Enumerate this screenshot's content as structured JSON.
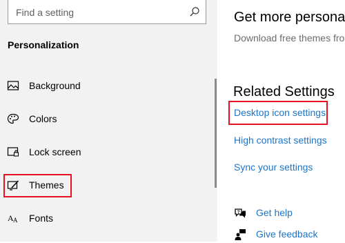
{
  "search": {
    "placeholder": "Find a setting",
    "icon": "search-icon"
  },
  "sidebar": {
    "section_title": "Personalization",
    "items": [
      {
        "label": "Background",
        "icon": "background-image-icon"
      },
      {
        "label": "Colors",
        "icon": "palette-icon"
      },
      {
        "label": "Lock screen",
        "icon": "lock-screen-icon"
      },
      {
        "label": "Themes",
        "icon": "themes-brush-icon",
        "highlighted": true
      },
      {
        "label": "Fonts",
        "icon": "fonts-icon"
      }
    ]
  },
  "main": {
    "get_more_title": "Get more personal",
    "get_more_desc": "Download free themes fro",
    "related_title": "Related Settings",
    "links": [
      {
        "label": "Desktop icon settings",
        "highlighted": true
      },
      {
        "label": "High contrast settings"
      },
      {
        "label": "Sync your settings"
      }
    ],
    "help": [
      {
        "label": "Get help",
        "icon": "chat-help-icon"
      },
      {
        "label": "Give feedback",
        "icon": "feedback-person-icon"
      }
    ]
  },
  "colors": {
    "link": "#1b74c8",
    "highlight": "#e81123",
    "sidebar_bg": "#f2f2f2"
  }
}
